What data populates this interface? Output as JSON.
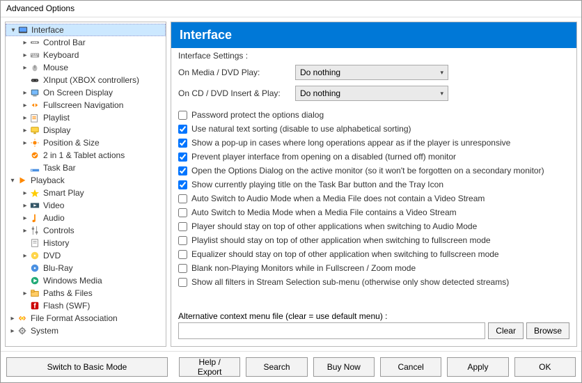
{
  "window": {
    "title": "Advanced Options"
  },
  "tree": {
    "items": [
      {
        "label": "Interface",
        "indent": 0,
        "arrow": "▾",
        "icon": "interface",
        "selected": true
      },
      {
        "label": "Control Bar",
        "indent": 1,
        "arrow": "▸",
        "icon": "controlbar"
      },
      {
        "label": "Keyboard",
        "indent": 1,
        "arrow": "▸",
        "icon": "keyboard"
      },
      {
        "label": "Mouse",
        "indent": 1,
        "arrow": "▸",
        "icon": "mouse"
      },
      {
        "label": "XInput (XBOX controllers)",
        "indent": 1,
        "arrow": "",
        "icon": "xinput"
      },
      {
        "label": "On Screen Display",
        "indent": 1,
        "arrow": "▸",
        "icon": "osd"
      },
      {
        "label": "Fullscreen Navigation",
        "indent": 1,
        "arrow": "▸",
        "icon": "fullscreen"
      },
      {
        "label": "Playlist",
        "indent": 1,
        "arrow": "▸",
        "icon": "playlist"
      },
      {
        "label": "Display",
        "indent": 1,
        "arrow": "▸",
        "icon": "display"
      },
      {
        "label": "Position & Size",
        "indent": 1,
        "arrow": "▸",
        "icon": "position"
      },
      {
        "label": "2 in 1 & Tablet actions",
        "indent": 1,
        "arrow": "",
        "icon": "tablet"
      },
      {
        "label": "Task Bar",
        "indent": 1,
        "arrow": "",
        "icon": "taskbar"
      },
      {
        "label": "Playback",
        "indent": 0,
        "arrow": "▾",
        "icon": "playback"
      },
      {
        "label": "Smart Play",
        "indent": 1,
        "arrow": "▸",
        "icon": "smartplay"
      },
      {
        "label": "Video",
        "indent": 1,
        "arrow": "▸",
        "icon": "video"
      },
      {
        "label": "Audio",
        "indent": 1,
        "arrow": "▸",
        "icon": "audio"
      },
      {
        "label": "Controls",
        "indent": 1,
        "arrow": "▸",
        "icon": "controls"
      },
      {
        "label": "History",
        "indent": 1,
        "arrow": "",
        "icon": "history"
      },
      {
        "label": "DVD",
        "indent": 1,
        "arrow": "▸",
        "icon": "dvd"
      },
      {
        "label": "Blu-Ray",
        "indent": 1,
        "arrow": "",
        "icon": "bluray"
      },
      {
        "label": "Windows Media",
        "indent": 1,
        "arrow": "",
        "icon": "wmedia"
      },
      {
        "label": "Paths & Files",
        "indent": 1,
        "arrow": "▸",
        "icon": "paths"
      },
      {
        "label": "Flash (SWF)",
        "indent": 1,
        "arrow": "",
        "icon": "flash"
      },
      {
        "label": "File Format Association",
        "indent": 0,
        "arrow": "▸",
        "icon": "fileformat"
      },
      {
        "label": "System",
        "indent": 0,
        "arrow": "▸",
        "icon": "system"
      }
    ]
  },
  "main": {
    "header": "Interface",
    "fieldset_label": "Interface Settings :",
    "row1_label": "On Media / DVD Play:",
    "row1_value": "Do nothing",
    "row2_label": "On CD / DVD Insert & Play:",
    "row2_value": "Do nothing",
    "checks": [
      {
        "label": "Password protect the options dialog",
        "checked": false
      },
      {
        "label": "Use natural text sorting (disable to use alphabetical sorting)",
        "checked": true
      },
      {
        "label": "Show a pop-up in cases where long operations appear as if the player is unresponsive",
        "checked": true
      },
      {
        "label": "Prevent player interface from opening on a disabled (turned off) monitor",
        "checked": true
      },
      {
        "label": "Open the Options Dialog on the active monitor (so it won't be forgotten on a secondary monitor)",
        "checked": true
      },
      {
        "label": "Show currently playing title on the Task Bar button and the Tray Icon",
        "checked": true
      },
      {
        "label": "Auto Switch to Audio Mode when a Media File does not contain a Video Stream",
        "checked": false
      },
      {
        "label": "Auto Switch to Media Mode when a Media File contains a Video Stream",
        "checked": false
      },
      {
        "label": "Player should stay on top of other applications when switching to Audio Mode",
        "checked": false
      },
      {
        "label": "Playlist should stay on top of other application when switching to fullscreen mode",
        "checked": false
      },
      {
        "label": "Equalizer should stay on top of other application when switching to fullscreen mode",
        "checked": false
      },
      {
        "label": "Blank non-Playing Monitors while in Fullscreen / Zoom mode",
        "checked": false
      },
      {
        "label": "Show all filters in Stream Selection sub-menu (otherwise only show detected streams)",
        "checked": false
      }
    ],
    "alt_label": "Alternative context menu file (clear = use default menu) :",
    "alt_value": "",
    "clear_btn": "Clear",
    "browse_btn": "Browse"
  },
  "footer": {
    "switch": "Switch to Basic Mode",
    "help": "Help / Export",
    "search": "Search",
    "buy": "Buy Now",
    "cancel": "Cancel",
    "apply": "Apply",
    "ok": "OK"
  }
}
